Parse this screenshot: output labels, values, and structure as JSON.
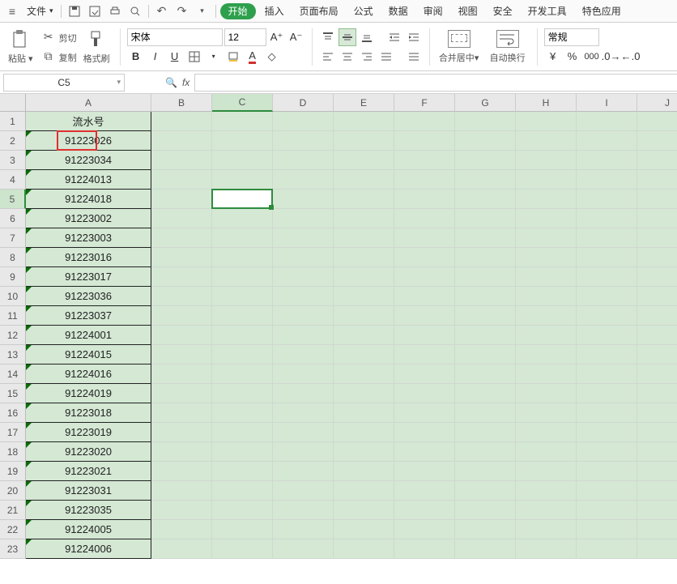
{
  "menubar": {
    "file_label": "文件",
    "tabs": [
      "开始",
      "插入",
      "页面布局",
      "公式",
      "数据",
      "审阅",
      "视图",
      "安全",
      "开发工具",
      "特色应用"
    ],
    "active_tab": 0
  },
  "ribbon": {
    "paste_label": "粘贴",
    "cut_label": "剪切",
    "copy_label": "复制",
    "format_painter_label": "格式刷",
    "font_name": "宋体",
    "font_size": "12",
    "merge_label": "合并居中",
    "wrap_label": "自动换行",
    "number_format": "常规"
  },
  "namebox": {
    "value": "C5"
  },
  "formula_bar": {
    "value": ""
  },
  "columns": [
    "A",
    "B",
    "C",
    "D",
    "E",
    "F",
    "G",
    "H",
    "I",
    "J"
  ],
  "col_widths": {
    "A": 155,
    "other": 75
  },
  "row_count": 23,
  "selected_cell": {
    "col": "C",
    "row": 5
  },
  "header_cell": {
    "text": "流水号"
  },
  "red_highlight": {
    "row": 2,
    "text_fragment": "9122"
  },
  "data_col_A": [
    "91223026",
    "91223034",
    "91224013",
    "91224018",
    "91223002",
    "91223003",
    "91223016",
    "91223017",
    "91223036",
    "91223037",
    "91224001",
    "91224015",
    "91224016",
    "91224019",
    "91223018",
    "91223019",
    "91223020",
    "91223021",
    "91223031",
    "91223035",
    "91224005",
    "91224006"
  ]
}
